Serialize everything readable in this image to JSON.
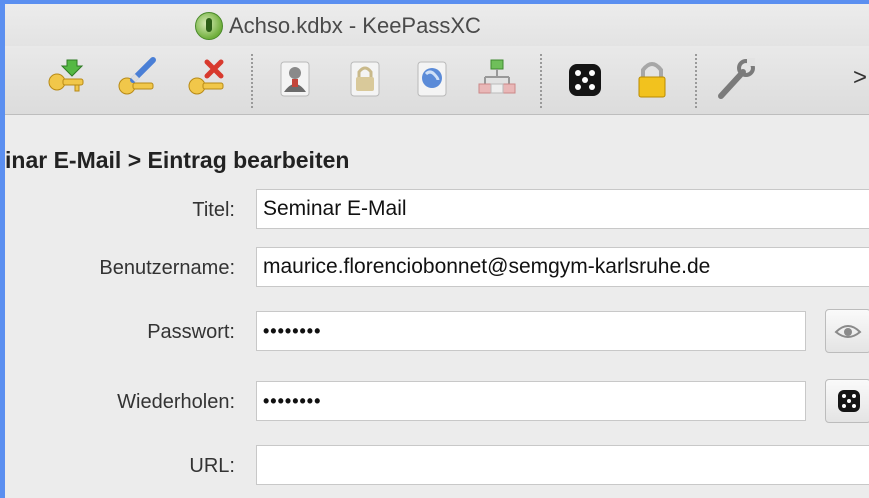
{
  "window": {
    "title": "Achso.kdbx - KeePassXC"
  },
  "toolbar": {
    "icons": [
      "key-add-icon",
      "key-edit-icon",
      "key-delete-icon",
      "copy-username-icon",
      "copy-password-icon",
      "open-url-icon",
      "merge-icon",
      "dice-icon",
      "lock-icon",
      "wrench-icon"
    ],
    "overflow_label": ">"
  },
  "breadcrumb": "inar E-Mail > Eintrag bearbeiten",
  "form": {
    "title_label": "Titel:",
    "title_value": "Seminar E-Mail",
    "username_label": "Benutzername:",
    "username_value": "maurice.florenciobonnet@semgym-karlsruhe.de",
    "password_label": "Passwort:",
    "password_value": "••••••••",
    "repeat_label": "Wiederholen:",
    "repeat_value": "••••••••",
    "url_label": "URL:",
    "url_value": ""
  },
  "colors": {
    "accent": "#5b8ff0",
    "background": "#ececec"
  }
}
